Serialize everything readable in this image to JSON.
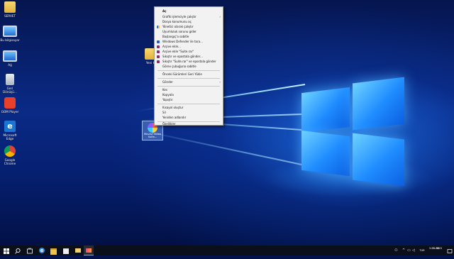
{
  "desktop_icons": [
    {
      "name": "SERVET",
      "icon": "folder-icon"
    },
    {
      "name": "Bu bilgisayar",
      "icon": "computer-icon"
    },
    {
      "name": "Ağ",
      "icon": "network-icon"
    },
    {
      "name": "Geri Dönüşü...",
      "icon": "recycle-bin-icon"
    },
    {
      "name": "GOM Player",
      "icon": "gom-player-icon"
    },
    {
      "name": "Microsoft Edge",
      "icon": "edge-icon"
    },
    {
      "name": "Google Chrome",
      "icon": "chrome-icon"
    }
  ],
  "center_icons": {
    "folder_label": "Yeni k",
    "selected_label": "Movavi Video Suite..."
  },
  "context_menu": {
    "items": [
      {
        "label": "Aç",
        "bold": true
      },
      {
        "label": "Grafik işlemciyle çalıştır",
        "submenu": true
      },
      {
        "label": "Dosya konumunu aç"
      },
      {
        "label": "Yönetici olarak çalıştır",
        "icon": "shield-icon"
      },
      {
        "label": "Uyumluluk sorunu gider"
      },
      {
        "label": "Başlangıç'a sabitle"
      },
      {
        "label": "Windows Defender ile tara...",
        "icon": "defender-icon"
      },
      {
        "label": "Arşive ekle...",
        "icon": "winrar-icon"
      },
      {
        "label": "Arşive ekle \"Suite.rar\"",
        "icon": "winrar-icon"
      },
      {
        "label": "Sıkıştır ve epostala gönder...",
        "icon": "winrar-icon"
      },
      {
        "label": "Sıkıştır \"Suite.rar\" ve epostala gönder",
        "icon": "winrar-icon"
      },
      {
        "label": "Görev çubuğuna sabitle"
      },
      {
        "label": "Önceki Sürümleri Geri Yükle"
      },
      {
        "label": "Gönder",
        "submenu": true
      },
      {
        "label": "Kes"
      },
      {
        "label": "Kopyala"
      },
      {
        "label": "Yapıştır"
      },
      {
        "label": "Kısayol oluştur"
      },
      {
        "label": "Sil"
      },
      {
        "label": "Yeniden adlandır"
      },
      {
        "label": "Özellikler"
      }
    ],
    "submenu_arrow": "›"
  },
  "taskbar": {
    "time": "11:30",
    "date": "3.05.2020",
    "language": "TUR",
    "pinned": [
      "start-icon",
      "search-icon",
      "task-view-icon",
      "edge-icon",
      "file-explorer-icon",
      "store-icon",
      "mail-icon",
      "media-app-icon"
    ]
  }
}
